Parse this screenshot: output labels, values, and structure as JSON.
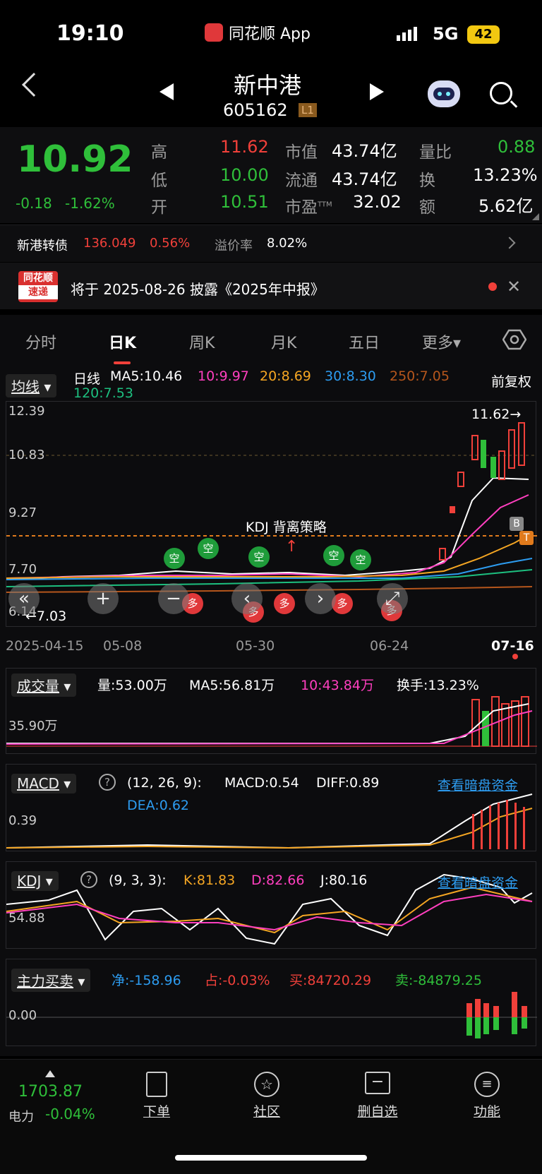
{
  "status_bar": {
    "time": "19:10",
    "app": "同花顺 App",
    "network": "5G",
    "battery": "42"
  },
  "header": {
    "name": "新中港",
    "code": "605162",
    "level": "L1"
  },
  "quote": {
    "price": "10.92",
    "change": "-0.18",
    "change_pct": "-1.62%",
    "high_label": "高",
    "high": "11.62",
    "low_label": "低",
    "low": "10.00",
    "open_label": "开",
    "open": "10.51",
    "mktcap_label": "市值",
    "mktcap": "43.74亿",
    "float_label": "流通",
    "float": "43.74亿",
    "pe_label": "市盈",
    "pe_sup": "TTM",
    "pe": "32.02",
    "volratio_label": "量比",
    "volratio": "0.88",
    "turnover_label": "换",
    "turnover": "13.23%",
    "amount_label": "额",
    "amount": "5.62亿"
  },
  "bond": {
    "name": "新港转债",
    "price": "136.049",
    "change": "0.56%",
    "premium_label": "溢价率",
    "premium": "8.02%"
  },
  "notice": {
    "logo_top": "同花顺",
    "logo_bottom": "速递",
    "text": "将于 2025-08-26 披露《2025年中报》"
  },
  "tabs": [
    "分时",
    "日K",
    "周K",
    "月K",
    "五日",
    "更多▾"
  ],
  "ma": {
    "selector": "均线",
    "period": "日线",
    "ma5": "MA5:10.46",
    "ma10": "10:9.97",
    "ma20": "20:8.69",
    "ma30": "30:8.30",
    "ma250": "250:7.05",
    "ma120": "120:7.53",
    "adjust": "前复权"
  },
  "kline": {
    "y_labels": [
      "12.39",
      "10.83",
      "9.27",
      "7.70",
      "6.14"
    ],
    "high_marker": "11.62→",
    "low_marker": "←7.03",
    "strategy_label": "KDJ 背离策略",
    "dates": [
      "2025-04-15",
      "05-08",
      "05-30",
      "06-24",
      "07-16"
    ],
    "buy_label": "B",
    "t_label": "T",
    "signal_short": "空",
    "signal_long": "多"
  },
  "volume": {
    "selector": "成交量",
    "vol": "量:53.00万",
    "ma5": "MA5:56.81万",
    "ma10": "10:43.84万",
    "turnover": "换手:13.23%",
    "y_label": "35.90万"
  },
  "macd": {
    "selector": "MACD",
    "params": "(12, 26, 9):",
    "macd": "MACD:0.54",
    "diff": "DIFF:0.89",
    "dea": "DEA:0.62",
    "link": "查看暗盘资金",
    "y_label": "0.39"
  },
  "kdj": {
    "selector": "KDJ",
    "params": "(9, 3, 3):",
    "k": "K:81.83",
    "d": "D:82.66",
    "j": "J:80.16",
    "link": "查看暗盘资金",
    "y_label": "54.88"
  },
  "main_force": {
    "selector": "主力买卖",
    "net": "净:-158.96",
    "ratio": "占:-0.03%",
    "buy": "买:84720.29",
    "sell": "卖:-84879.25",
    "y_label": "0.00"
  },
  "bottom_nav": {
    "index_value": "1703.87",
    "index_name": "电力",
    "index_change": "-0.04%",
    "items": [
      "下单",
      "社区",
      "删自选",
      "功能"
    ]
  }
}
